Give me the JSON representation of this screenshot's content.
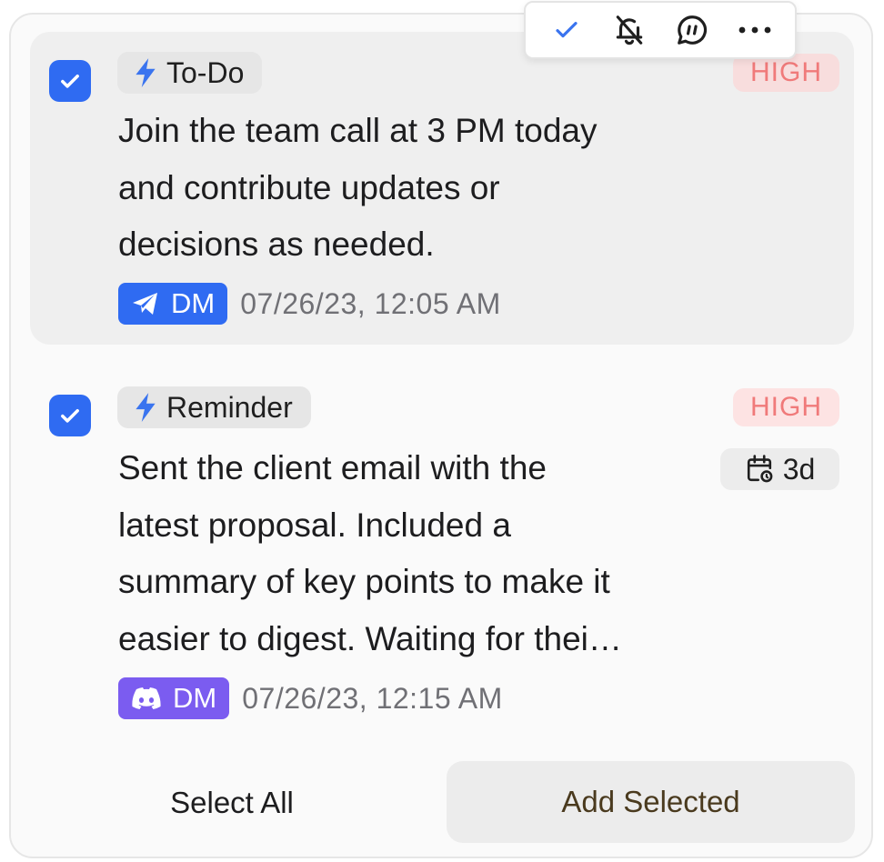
{
  "toolbar": {
    "icons": [
      "check-icon",
      "bell-off-icon",
      "chat-bubble-icon",
      "more-icon"
    ],
    "accent": "#2f6bf2"
  },
  "items": [
    {
      "checked": true,
      "tag_icon": "lightning-icon",
      "tag_label": "To-Do",
      "priority": "HIGH",
      "lines": [
        "Join the team call at 3 PM today",
        "and contribute updates or",
        "decisions as needed."
      ],
      "source_icon": "telegram-icon",
      "source_label": "DM",
      "source_color": "#2f6bf2",
      "timestamp": "07/26/23, 12:05 AM"
    },
    {
      "checked": true,
      "tag_icon": "lightning-icon",
      "tag_label": "Reminder",
      "priority": "HIGH",
      "due_icon": "calendar-clock-icon",
      "due_label": "3d",
      "lines": [
        "Sent the client email with the",
        "latest proposal. Included a",
        "summary of key points to make it",
        "easier to digest. Waiting for thei…"
      ],
      "source_icon": "discord-icon",
      "source_label": "DM",
      "source_color": "#7b5cf0",
      "timestamp": "07/26/23, 12:15 AM"
    }
  ],
  "footer": {
    "select_all_label": "Select All",
    "add_selected_label": "Add Selected"
  },
  "colors": {
    "priority_text": "#f07a7a",
    "priority_bg": "#fde3e3"
  }
}
